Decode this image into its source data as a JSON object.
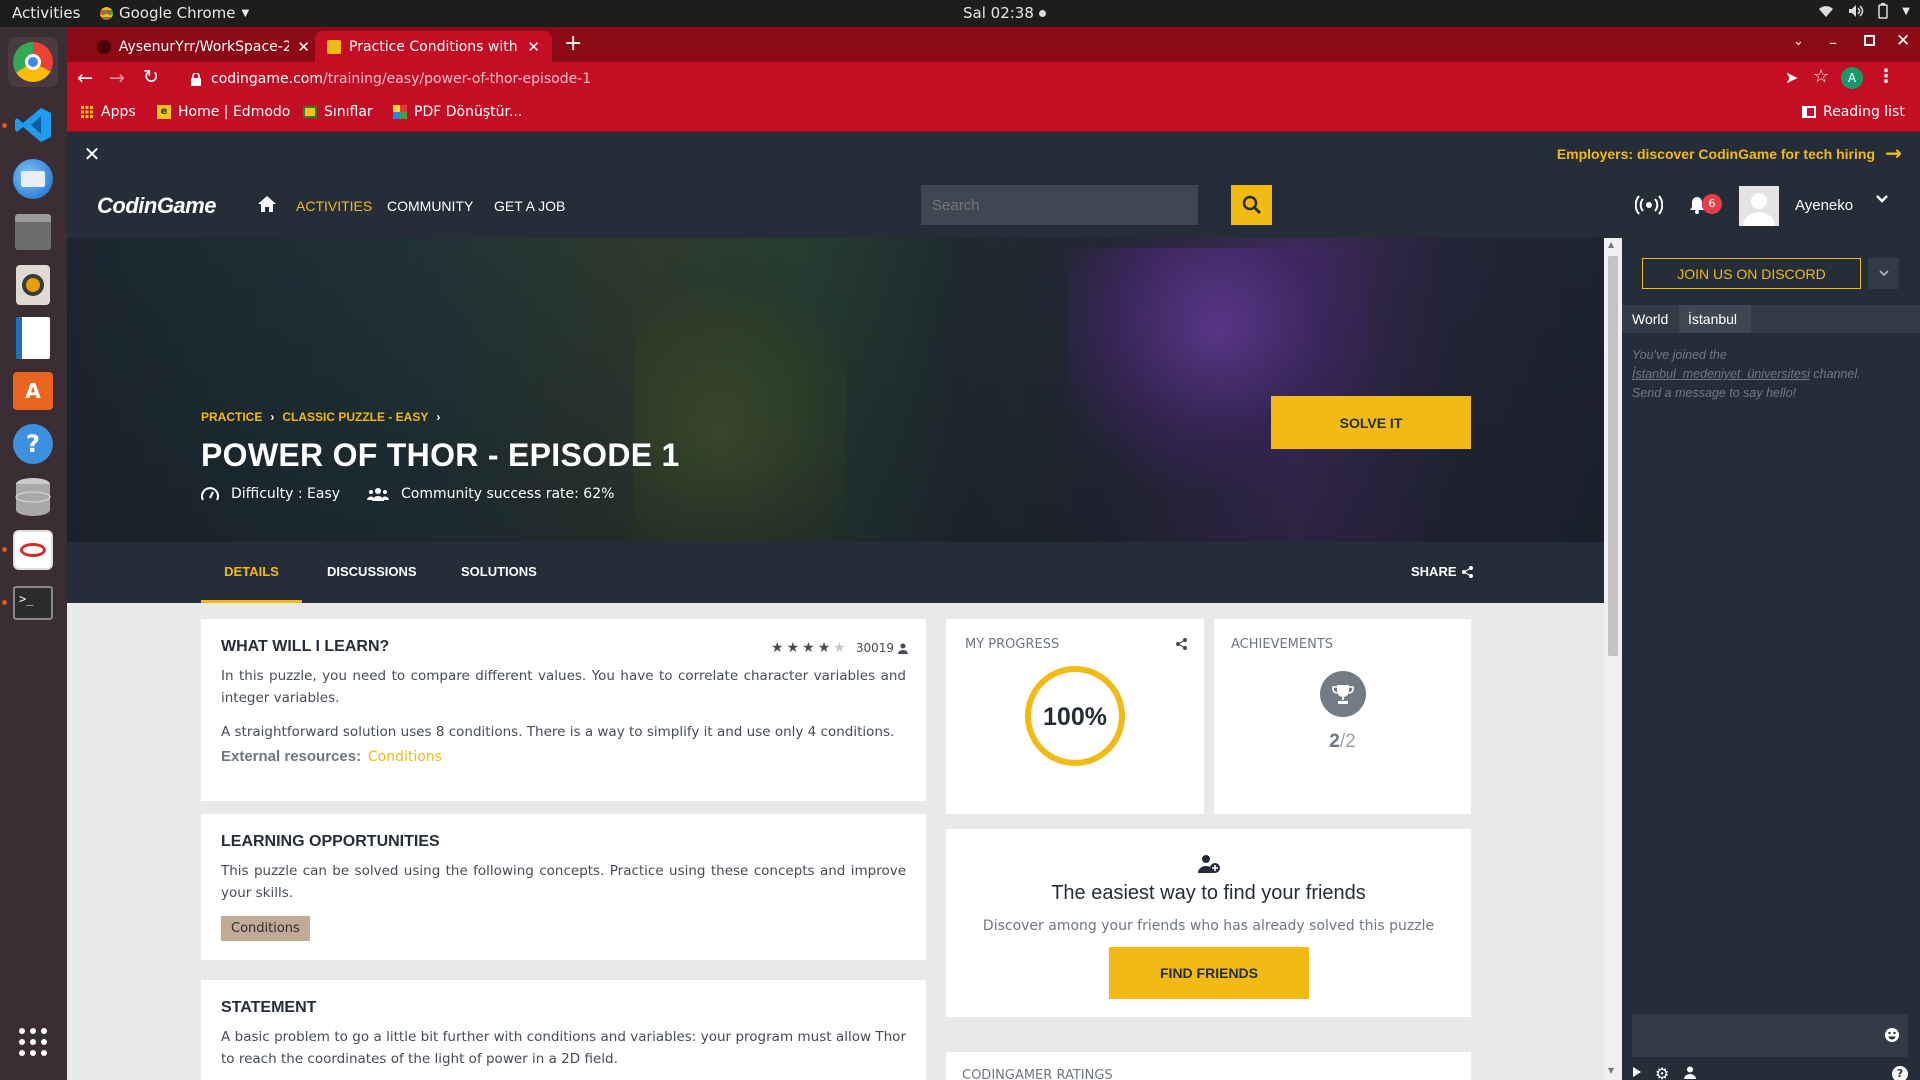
{
  "os": {
    "activities": "Activities",
    "app_name": "Google Chrome",
    "clock": "Sal 02:38"
  },
  "browser": {
    "tabs": [
      {
        "title": "AysenurYrr/WorkSpace-2"
      },
      {
        "title": "Practice Conditions with"
      }
    ],
    "url_domain": "codingame.com",
    "url_path": "/training/easy/power-of-thor-episode-1",
    "profile_initial": "A",
    "bookmarks": [
      "Apps",
      "Home | Edmodo",
      "Sınıflar",
      "PDF Dönüştür..."
    ],
    "reading_list": "Reading list"
  },
  "banner": {
    "employers": "Employers: discover CodinGame for tech hiring"
  },
  "nav": {
    "logo": "CodinGame",
    "links": [
      "ACTIVITIES",
      "COMMUNITY",
      "GET A JOB"
    ],
    "search_placeholder": "Search",
    "notifications": "6",
    "username": "Ayeneko"
  },
  "hero": {
    "breadcrumb": [
      "PRACTICE",
      "CLASSIC PUZZLE - EASY"
    ],
    "title": "POWER OF THOR - EPISODE 1",
    "difficulty": "Difficulty : Easy",
    "success_rate": "Community success rate: 62%",
    "solve_button": "SOLVE IT"
  },
  "tabs": {
    "items": [
      "DETAILS",
      "DISCUSSIONS",
      "SOLUTIONS"
    ],
    "share": "SHARE"
  },
  "learn": {
    "heading": "WHAT WILL I LEARN?",
    "rating_stars": 4,
    "rating_count": "30019",
    "para1": "In this puzzle, you need to compare different values. You have to correlate character variables and integer variables.",
    "para2": "A straightforward solution uses 8 conditions. There is a way to simplify it and use only 4 conditions.",
    "external_label": "External resources:",
    "external_link": "Conditions"
  },
  "opportunities": {
    "heading": "LEARNING OPPORTUNITIES",
    "text": "This puzzle can be solved using the following concepts. Practice using these concepts and improve your skills.",
    "tag": "Conditions"
  },
  "statement": {
    "heading": "STATEMENT",
    "text": "A basic problem to go a little bit further with conditions and variables: your program must allow Thor to reach the coordinates of the light of power in a 2D field."
  },
  "progress": {
    "label": "MY PROGRESS",
    "value": "100%",
    "fraction": 1.0
  },
  "achievements": {
    "label": "ACHIEVEMENTS",
    "earned": "2",
    "total": "/2"
  },
  "friends": {
    "heading": "The easiest way to find your friends",
    "text": "Discover among your friends who has already solved this puzzle",
    "button": "FIND FRIENDS"
  },
  "ratings": {
    "label": "CODINGAMER RATINGS"
  },
  "chat": {
    "discord": "JOIN US ON DISCORD",
    "tabs": [
      "World",
      "İstanbul"
    ],
    "line1": "You've joined the",
    "line2_channel": "İstanbul_medeniyet_üniversitesi",
    "line2_suffix": " channel.",
    "line3": "Send a message to say hello!"
  },
  "colors": {
    "accent": "#f2bb13",
    "nav_bg": "#252e38",
    "chrome_red": "#c30e23"
  }
}
